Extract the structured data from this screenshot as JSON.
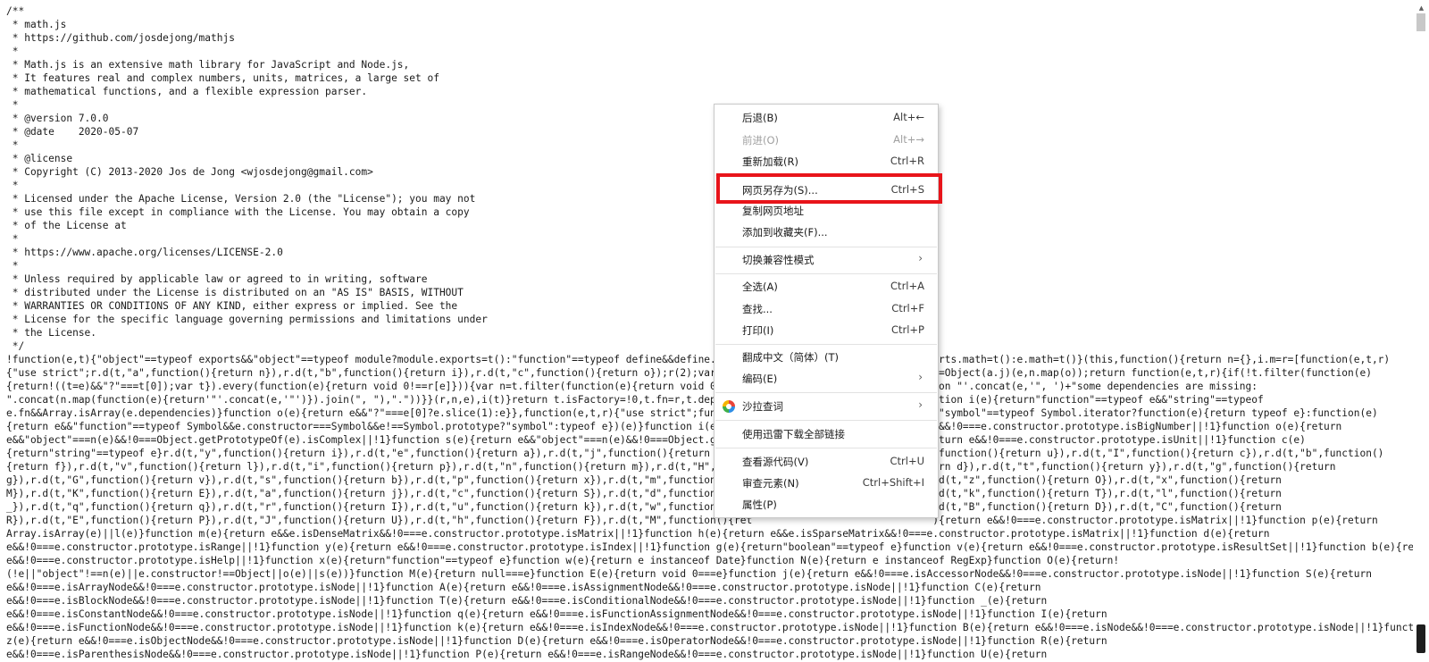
{
  "code_lines": [
    "/**",
    " * math.js",
    " * https://github.com/josdejong/mathjs",
    " *",
    " * Math.js is an extensive math library for JavaScript and Node.js,",
    " * It features real and complex numbers, units, matrices, a large set of",
    " * mathematical functions, and a flexible expression parser.",
    " *",
    " * @version 7.0.0",
    " * @date    2020-05-07",
    " *",
    " * @license",
    " * Copyright (C) 2013-2020 Jos de Jong <wjosdejong@gmail.com>",
    " *",
    " * Licensed under the Apache License, Version 2.0 (the \"License\"); you may not",
    " * use this file except in compliance with the License. You may obtain a copy",
    " * of the License at",
    " *",
    " * https://www.apache.org/licenses/LICENSE-2.0",
    " *",
    " * Unless required by applicable law or agreed to in writing, software",
    " * distributed under the License is distributed on an \"AS IS\" BASIS, WITHOUT",
    " * WARRANTIES OR CONDITIONS OF ANY KIND, either express or implied. See the",
    " * License for the specific language governing permissions and limitations under",
    " * the License.",
    " */",
    "!function(e,t){\"object\"==typeof exports&&\"object\"==typeof module?module.exports=t():\"function\"==typeof define&&define.amd?def                              rts.math=t():e.math=t()}(this,function(){return n={},i.m=r=[function(e,t,r)",
    "{\"use strict\";r.d(t,\"a\",function(){return n}),r.d(t,\"b\",function(){return i}),r.d(t,\"c\",function(){return o});r(2);var a=r(3                              t=Object(a.j)(e,n.map(o));return function(e,t,r){if(!t.filter(function(e)",
    "{return!((t=e)&&\"?\"===t[0]);var t}).every(function(e){return void 0!==r[e]})){var n=t.filter(function(e){return void 0===r[e                              ion \"'.concat(e,'\", ')+\"some dependencies are missing:",
    "\".concat(n.map(function(e){return'\"'.concat(e,'\"')}).join(\", \"),\".\"))}}(r,n,e),i(t)}return t.isFactory=!0,t.fn=r,t.dependenc                              ction i(e){return\"function\"==typeof e&&\"string\"==typeof",
    "e.fn&&Array.isArray(e.dependencies)}function o(e){return e&&\"?\"===e[0]?e.slice(1):e}},function(e,t,r){\"use strict\";function                               &\"symbol\"==typeof Symbol.iterator?function(e){return typeof e}:function(e)",
    "{return e&&\"function\"==typeof Symbol&&e.constructor===Symbol&&e!==Symbol.prototype?\"symbol\":typeof e})(e)}function i(e)                               urn e&&!0===e.constructor.prototype.isBigNumber||!1}function o(e){return",
    "e&&\"object\"===n(e)&&!0===Object.getPrototypeOf(e).isComplex||!1}function s(e){return e&&\"object\"===n(e)&&!0===Object.getProt                              eturn e&&!0===e.constructor.prototype.isUnit||!1}function c(e)",
    "{return\"string\"==typeof e}r.d(t,\"y\",function(){return i}),r.d(t,\"e\",function(){return a}),r.d(t,\"j\",function(){return o}),r.                               function(){return u}),r.d(t,\"I\",function(){return c}),r.d(t,\"b\",function()",
    "{return f}),r.d(t,\"v\",function(){return l}),r.d(t,\"i\",function(){return p}),r.d(t,\"n\",function(){return m}),r.d(t,\"H\",functi                              urn d}),r.d(t,\"t\",function(){return y}),r.d(t,\"g\",function(){return",
    "g}),r.d(t,\"G\",function(){return v}),r.d(t,\"s\",function(){return b}),r.d(t,\"p\",function(){return x}),r.d(t,\"m\",function(){ret                              .d(t,\"z\",function(){return O}),r.d(t,\"x\",function(){return",
    "M}),r.d(t,\"K\",function(){return E}),r.d(t,\"a\",function(){return j}),r.d(t,\"c\",function(){return S}),r.d(t,\"d\",function(){ret                              .d(t,\"k\",function(){return T}),r.d(t,\"l\",function(){return",
    "_}),r.d(t,\"q\",function(){return q}),r.d(t,\"r\",function(){return I}),r.d(t,\"u\",function(){return k}),r.d(t,\"w\",function(){ret                              .d(t,\"B\",function(){return D}),r.d(t,\"C\",function(){return",
    "R}),r.d(t,\"E\",function(){return P}),r.d(t,\"J\",function(){return U}),r.d(t,\"h\",function(){return F}),r.d(t,\"M\",function(){ret                              ){return e&&!0===e.constructor.prototype.isMatrix||!1}function p(e){return",
    "Array.isArray(e)||l(e)}function m(e){return e&&e.isDenseMatrix&&!0===e.constructor.prototype.isMatrix||!1}function h(e){return e&&e.isSparseMatrix&&!0===e.constructor.prototype.isMatrix||!1}function d(e){return",
    "e&&!0===e.constructor.prototype.isRange||!1}function y(e){return e&&!0===e.constructor.prototype.isIndex||!1}function g(e){return\"boolean\"==typeof e}function v(e){return e&&!0===e.constructor.prototype.isResultSet||!1}function b(e){return",
    "e&&!0===e.constructor.prototype.isHelp||!1}function x(e){return\"function\"==typeof e}function w(e){return e instanceof Date}function N(e){return e instanceof RegExp}function O(e){return!",
    "(!e||\"object\"!==n(e)||e.constructor!==Object||o(e)||s(e))}function M(e){return null===e}function E(e){return void 0===e}function j(e){return e&&!0===e.isAccessorNode&&!0===e.constructor.prototype.isNode||!1}function S(e){return",
    "e&&!0===e.isArrayNode&&!0===e.constructor.prototype.isNode||!1}function A(e){return e&&!0===e.isAssignmentNode&&!0===e.constructor.prototype.isNode||!1}function C(e){return",
    "e&&!0===e.isBlockNode&&!0===e.constructor.prototype.isNode||!1}function T(e){return e&&!0===e.isConditionalNode&&!0===e.constructor.prototype.isNode||!1}function _(e){return",
    "e&&!0===e.isConstantNode&&!0===e.constructor.prototype.isNode||!1}function q(e){return e&&!0===e.isFunctionAssignmentNode&&!0===e.constructor.prototype.isNode||!1}function I(e){return",
    "e&&!0===e.isFunctionNode&&!0===e.constructor.prototype.isNode||!1}function k(e){return e&&!0===e.isIndexNode&&!0===e.constructor.prototype.isNode||!1}function B(e){return e&&!0===e.isNode&&!0===e.constructor.prototype.isNode||!1}function",
    "z(e){return e&&!0===e.isObjectNode&&!0===e.constructor.prototype.isNode||!1}function D(e){return e&&!0===e.isOperatorNode&&!0===e.constructor.prototype.isNode||!1}function R(e){return",
    "e&&!0===e.isParenthesisNode&&!0===e.constructor.prototype.isNode||!1}function P(e){return e&&!0===e.isRangeNode&&!0===e.constructor.prototype.isNode||!1}function U(e){return"
  ],
  "context_menu": {
    "items": [
      {
        "label": "后退(B)",
        "shortcut": "Alt+←",
        "disabled": false
      },
      {
        "label": "前进(O)",
        "shortcut": "Alt+→",
        "disabled": true
      },
      {
        "label": "重新加载(R)",
        "shortcut": "Ctrl+R",
        "disabled": false
      },
      {
        "label": "网页另存为(S)...",
        "shortcut": "Ctrl+S",
        "disabled": false
      },
      {
        "label": "复制网页地址",
        "shortcut": "",
        "disabled": false
      },
      {
        "label": "添加到收藏夹(F)...",
        "shortcut": "",
        "disabled": false
      },
      {
        "label": "切换兼容性模式",
        "shortcut": "",
        "submenu": true
      },
      {
        "label": "全选(A)",
        "shortcut": "Ctrl+A",
        "disabled": false
      },
      {
        "label": "查找...",
        "shortcut": "Ctrl+F",
        "disabled": false
      },
      {
        "label": "打印(I)",
        "shortcut": "Ctrl+P",
        "disabled": false
      },
      {
        "label": "翻成中文（简体）(T)",
        "shortcut": "",
        "disabled": false
      },
      {
        "label": "编码(E)",
        "shortcut": "",
        "submenu": true
      },
      {
        "label": "沙拉查词",
        "shortcut": "",
        "submenu": true,
        "icon": "sala-dictionary-icon"
      },
      {
        "label": "使用迅雷下载全部链接",
        "shortcut": "",
        "disabled": false
      },
      {
        "label": "查看源代码(V)",
        "shortcut": "Ctrl+U",
        "disabled": false
      },
      {
        "label": "审查元素(N)",
        "shortcut": "Ctrl+Shift+I",
        "disabled": false
      },
      {
        "label": "属性(P)",
        "shortcut": "",
        "disabled": false
      }
    ],
    "highlighted_item": "网页另存为(S)...",
    "highlight_color": "#e8141a"
  },
  "scrollbar": {
    "up_arrow_icon": "scroll-up-arrow-icon",
    "thumb_color": "#1e1e1e"
  }
}
